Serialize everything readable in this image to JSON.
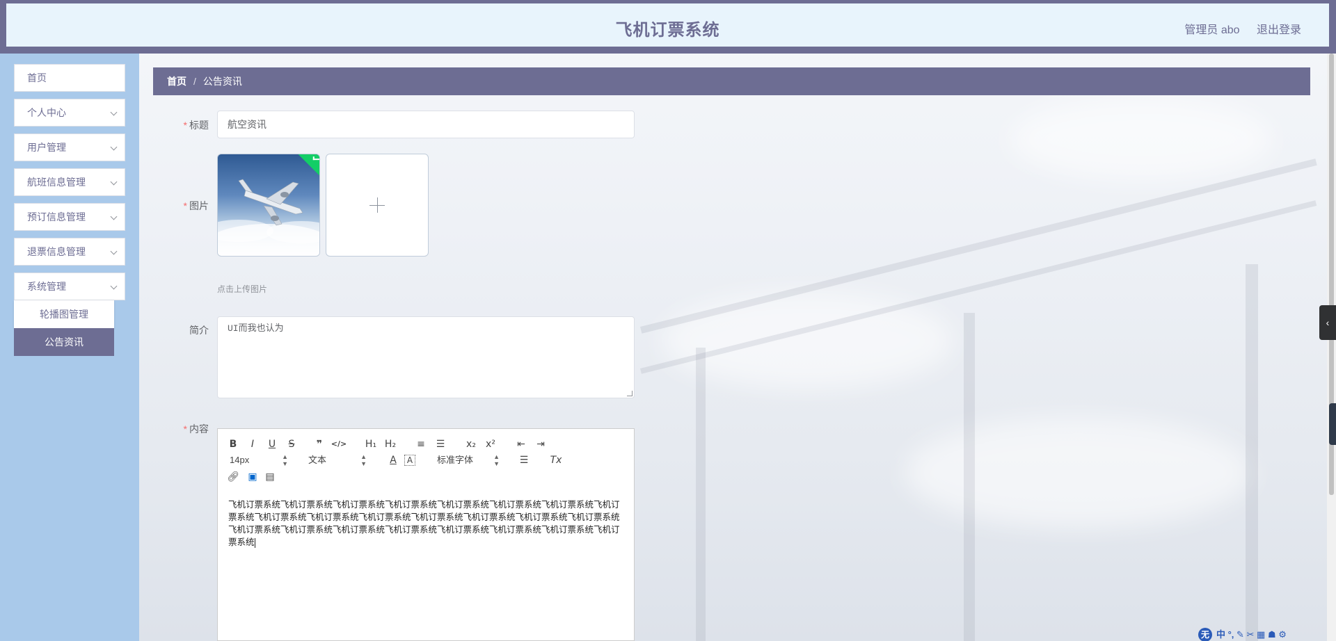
{
  "header": {
    "title": "飞机订票系统",
    "user": "管理员 abo",
    "logout": "退出登录"
  },
  "sidebar": {
    "items": [
      {
        "label": "首页",
        "has_children": false
      },
      {
        "label": "个人中心",
        "has_children": true
      },
      {
        "label": "用户管理",
        "has_children": true
      },
      {
        "label": "航班信息管理",
        "has_children": true
      },
      {
        "label": "预订信息管理",
        "has_children": true
      },
      {
        "label": "退票信息管理",
        "has_children": true
      },
      {
        "label": "系统管理",
        "has_children": true,
        "expanded": true
      }
    ],
    "submenu": [
      {
        "label": "轮播图管理",
        "active": false
      },
      {
        "label": "公告资讯",
        "active": true
      }
    ]
  },
  "breadcrumb": {
    "home": "首页",
    "separator": "/",
    "current": "公告资讯"
  },
  "form": {
    "title_label": "标题",
    "title_value": "航空资讯",
    "image_label": "图片",
    "upload_hint": "点击上传图片",
    "intro_label": "简介",
    "intro_value": "UI而我也认为",
    "content_label": "内容"
  },
  "editor": {
    "toolbar_row1": [
      "B",
      "I",
      "U",
      "S",
      "❞",
      "</>",
      "H₁",
      "H₂",
      "≡",
      "☰",
      "x₂",
      "x²",
      "⇤",
      "⇥"
    ],
    "font_size": "14px",
    "text_type": "文本",
    "font_family": "标准字体",
    "content": "飞机订票系统飞机订票系统飞机订票系统飞机订票系统飞机订票系统飞机订票系统飞机订票系统飞机订票系统飞机订票系统飞机订票系统飞机订票系统飞机订票系统飞机订票系统飞机订票系统飞机订票系统飞机订票系统飞机订票系统飞机订票系统飞机订票系统飞机订票系统飞机订票系统飞机订票系统飞机订票系统"
  },
  "ime": {
    "logo": "无",
    "items": "中 °, ✎ ✂ ▦ ☗ ⚙"
  },
  "colors": {
    "primary": "#6d6d93",
    "header_bg": "#e8f4fc",
    "sidebar_bg": "#a9c9ea",
    "required": "#f56c6c",
    "success": "#13ce66"
  }
}
